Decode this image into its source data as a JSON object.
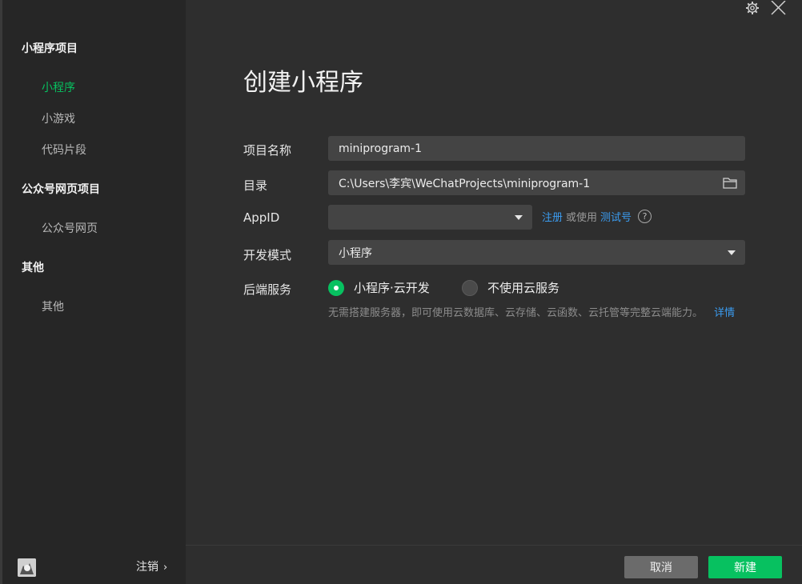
{
  "sidebar": {
    "sections": [
      {
        "title": "小程序项目",
        "items": [
          "小程序",
          "小游戏",
          "代码片段"
        ]
      },
      {
        "title": "公众号网页项目",
        "items": [
          "公众号网页"
        ]
      },
      {
        "title": "其他",
        "items": [
          "其他"
        ]
      }
    ],
    "active_item": "小程序",
    "logout_label": "注销",
    "logout_chevron": "›"
  },
  "header": {
    "title": "创建小程序",
    "icons": [
      "gear-icon",
      "close-icon"
    ]
  },
  "form": {
    "project_name": {
      "label": "项目名称",
      "value": "miniprogram-1"
    },
    "directory": {
      "label": "目录",
      "value": "C:\\Users\\李宾\\WeChatProjects\\miniprogram-1",
      "icon": "folder-icon"
    },
    "appid": {
      "label": "AppID",
      "value": "",
      "register_link": "注册",
      "or_use_text": "或使用",
      "test_account_link": "测试号",
      "help_icon": "?"
    },
    "dev_mode": {
      "label": "开发模式",
      "value": "小程序"
    },
    "backend": {
      "label": "后端服务",
      "options": [
        "小程序·云开发",
        "不使用云服务"
      ],
      "selected": "小程序·云开发",
      "description": "无需搭建服务器，即可使用云数据库、云存储、云函数、云托管等完整云端能力。",
      "details_link": "详情"
    }
  },
  "footer": {
    "cancel_label": "取消",
    "create_label": "新建"
  },
  "colors": {
    "accent": "#07c160",
    "link": "#3b9cf0",
    "sidebar_bg": "#262626",
    "main_bg": "#2e2e2e",
    "field_bg": "#444444"
  }
}
